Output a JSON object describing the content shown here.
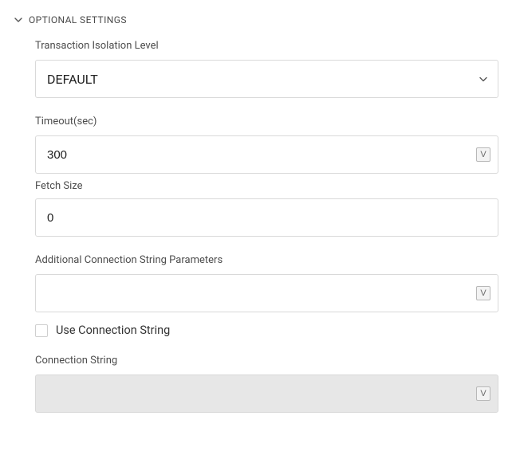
{
  "section": {
    "title": "OPTIONAL SETTINGS"
  },
  "fields": {
    "isolation": {
      "label": "Transaction Isolation Level",
      "value": "DEFAULT"
    },
    "timeout": {
      "label": "Timeout(sec)",
      "value": "300"
    },
    "fetchSize": {
      "label": "Fetch Size",
      "value": "0"
    },
    "additionalParams": {
      "label": "Additional Connection String Parameters",
      "value": ""
    },
    "useConnectionString": {
      "label": "Use Connection String",
      "checked": false
    },
    "connectionString": {
      "label": "Connection String",
      "value": ""
    }
  },
  "icons": {
    "variable_badge": "V"
  }
}
